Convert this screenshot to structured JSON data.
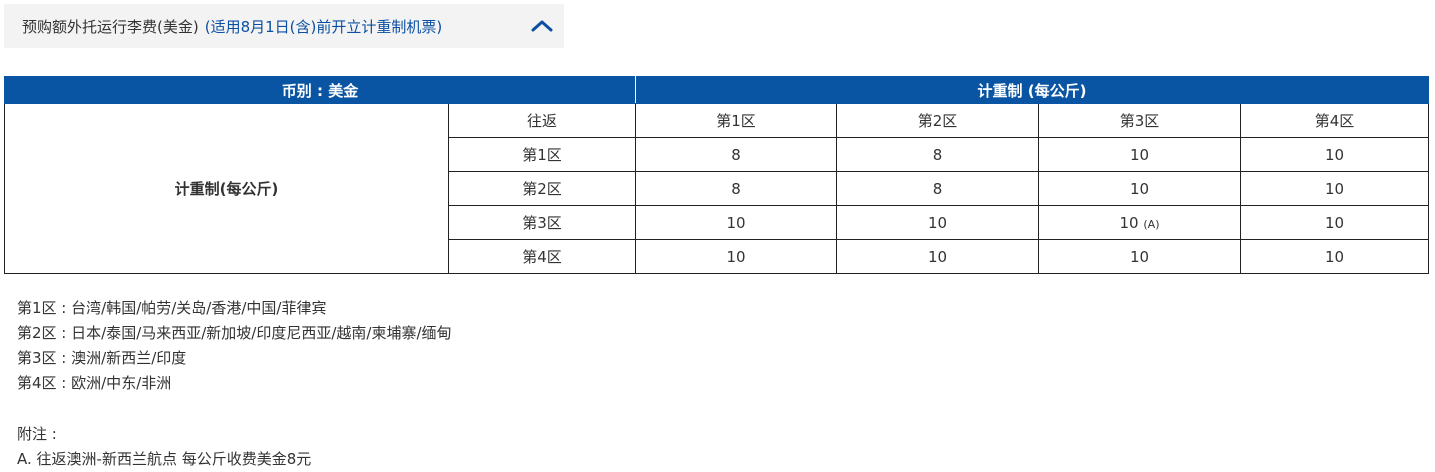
{
  "accordion": {
    "title": "预购额外托运行李费(美金)",
    "subtitle": "(适用8月1日(含)前开立计重制机票)",
    "expanded": true,
    "toggle_icon": "chevron-up-icon",
    "accent_color": "#0b4fa3"
  },
  "table": {
    "header_color": "#0a55a3",
    "currency_header": "币别 : 美金",
    "weight_header": "计重制 (每公斤)",
    "row_label": "计重制(每公斤)",
    "corner_label": "往返",
    "column_zones": [
      "第1区",
      "第2区",
      "第3区",
      "第4区"
    ],
    "rows": [
      {
        "zone": "第1区",
        "values": [
          "8",
          "8",
          "10",
          "10"
        ]
      },
      {
        "zone": "第2区",
        "values": [
          "8",
          "8",
          "10",
          "10"
        ]
      },
      {
        "zone": "第3区",
        "values": [
          "10",
          "10",
          "10",
          "10"
        ],
        "note_index": 2,
        "note": "(A)"
      },
      {
        "zone": "第4区",
        "values": [
          "10",
          "10",
          "10",
          "10"
        ]
      }
    ]
  },
  "zones": [
    "第1区 : 台湾/韩国/帕劳/关岛/香港/中国/菲律宾",
    "第2区 : 日本/泰国/马来西亚/新加坡/印度尼西亚/越南/柬埔寨/缅甸",
    "第3区 : 澳洲/新西兰/印度",
    "第4区 : 欧洲/中东/非洲"
  ],
  "footnotes": {
    "title": "附注 :",
    "items": [
      "A. 往返澳洲-新西兰航点 每公斤收费美金8元"
    ]
  }
}
